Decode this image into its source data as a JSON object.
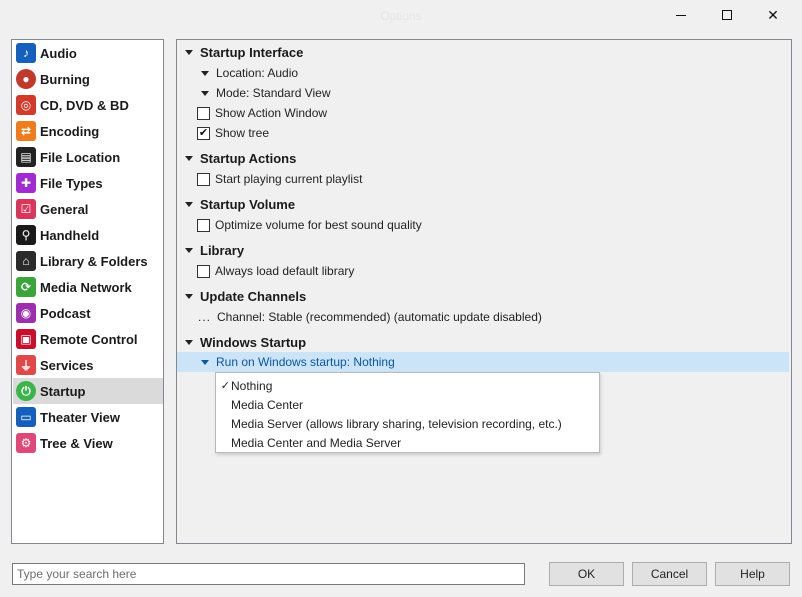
{
  "window": {
    "title": "Options",
    "minimize_icon": "minimize-icon",
    "maximize_icon": "maximize-icon",
    "close_icon": "close-icon",
    "close_glyph": "✕"
  },
  "sidebar": {
    "items": [
      {
        "label": "Audio",
        "icon": "music-note-icon",
        "glyph": "♪",
        "color": "#1560bd"
      },
      {
        "label": "Burning",
        "icon": "disc-burn-icon",
        "glyph": "●",
        "color": "#c0392b"
      },
      {
        "label": "CD, DVD & BD",
        "icon": "disc-icon",
        "glyph": "◎",
        "color": "#d43a2a"
      },
      {
        "label": "Encoding",
        "icon": "convert-icon",
        "glyph": "⇄",
        "color": "#f07c1e"
      },
      {
        "label": "File Location",
        "icon": "file-location-icon",
        "glyph": "▤",
        "color": "#222222"
      },
      {
        "label": "File Types",
        "icon": "puzzle-icon",
        "glyph": "✚",
        "color": "#a12bd1"
      },
      {
        "label": "General",
        "icon": "checkbox-icon",
        "glyph": "☑",
        "color": "#d9365b"
      },
      {
        "label": "Handheld",
        "icon": "usb-icon",
        "glyph": "⚲",
        "color": "#1a1a1a"
      },
      {
        "label": "Library & Folders",
        "icon": "home-icon",
        "glyph": "⌂",
        "color": "#2b2b2b"
      },
      {
        "label": "Media Network",
        "icon": "network-icon",
        "glyph": "⟳",
        "color": "#3aa53a"
      },
      {
        "label": "Podcast",
        "icon": "podcast-icon",
        "glyph": "◉",
        "color": "#9b2fae"
      },
      {
        "label": "Remote Control",
        "icon": "remote-icon",
        "glyph": "▣",
        "color": "#c8102e"
      },
      {
        "label": "Services",
        "icon": "plug-icon",
        "glyph": "⏚",
        "color": "#e0484a"
      },
      {
        "label": "Startup",
        "icon": "power-icon",
        "glyph": "⏻",
        "color": "#3bb54a",
        "selected": true
      },
      {
        "label": "Theater View",
        "icon": "monitor-icon",
        "glyph": "▭",
        "color": "#1560bd"
      },
      {
        "label": "Tree & View",
        "icon": "gear-icon",
        "glyph": "⚙",
        "color": "#e0487a"
      }
    ]
  },
  "options": {
    "startup_interface": {
      "header": "Startup Interface",
      "location": "Location: Audio",
      "mode": "Mode: Standard View",
      "show_action_window": "Show Action Window",
      "show_action_window_checked": false,
      "show_tree": "Show tree",
      "show_tree_checked": true,
      "check_glyph": "✔"
    },
    "startup_actions": {
      "header": "Startup Actions",
      "start_playing": "Start playing current playlist",
      "start_playing_checked": false
    },
    "startup_volume": {
      "header": "Startup Volume",
      "optimize": "Optimize volume for best sound quality",
      "optimize_checked": false
    },
    "library": {
      "header": "Library",
      "always_load": "Always load default library",
      "always_load_checked": false
    },
    "update_channels": {
      "header": "Update Channels",
      "ellipsis": "...",
      "channel": "Channel: Stable (recommended) (automatic update disabled)"
    },
    "windows_startup": {
      "header": "Windows Startup",
      "run_on_startup": "Run on Windows startup: Nothing"
    }
  },
  "dropdown": {
    "selected_mark": "✓",
    "options": [
      {
        "label": "Nothing",
        "selected": true
      },
      {
        "label": "Media Center",
        "selected": false
      },
      {
        "label": "Media Server (allows library sharing, television recording, etc.)",
        "selected": false
      },
      {
        "label": "Media Center and Media Server",
        "selected": false
      }
    ]
  },
  "footer": {
    "search_placeholder": "Type your search here",
    "ok_label": "OK",
    "cancel_label": "Cancel",
    "help_label": "Help"
  },
  "colors": {
    "highlight_bg": "#cce4f7",
    "highlight_text": "#0a56a8",
    "selected_nav_bg": "#dadada"
  }
}
